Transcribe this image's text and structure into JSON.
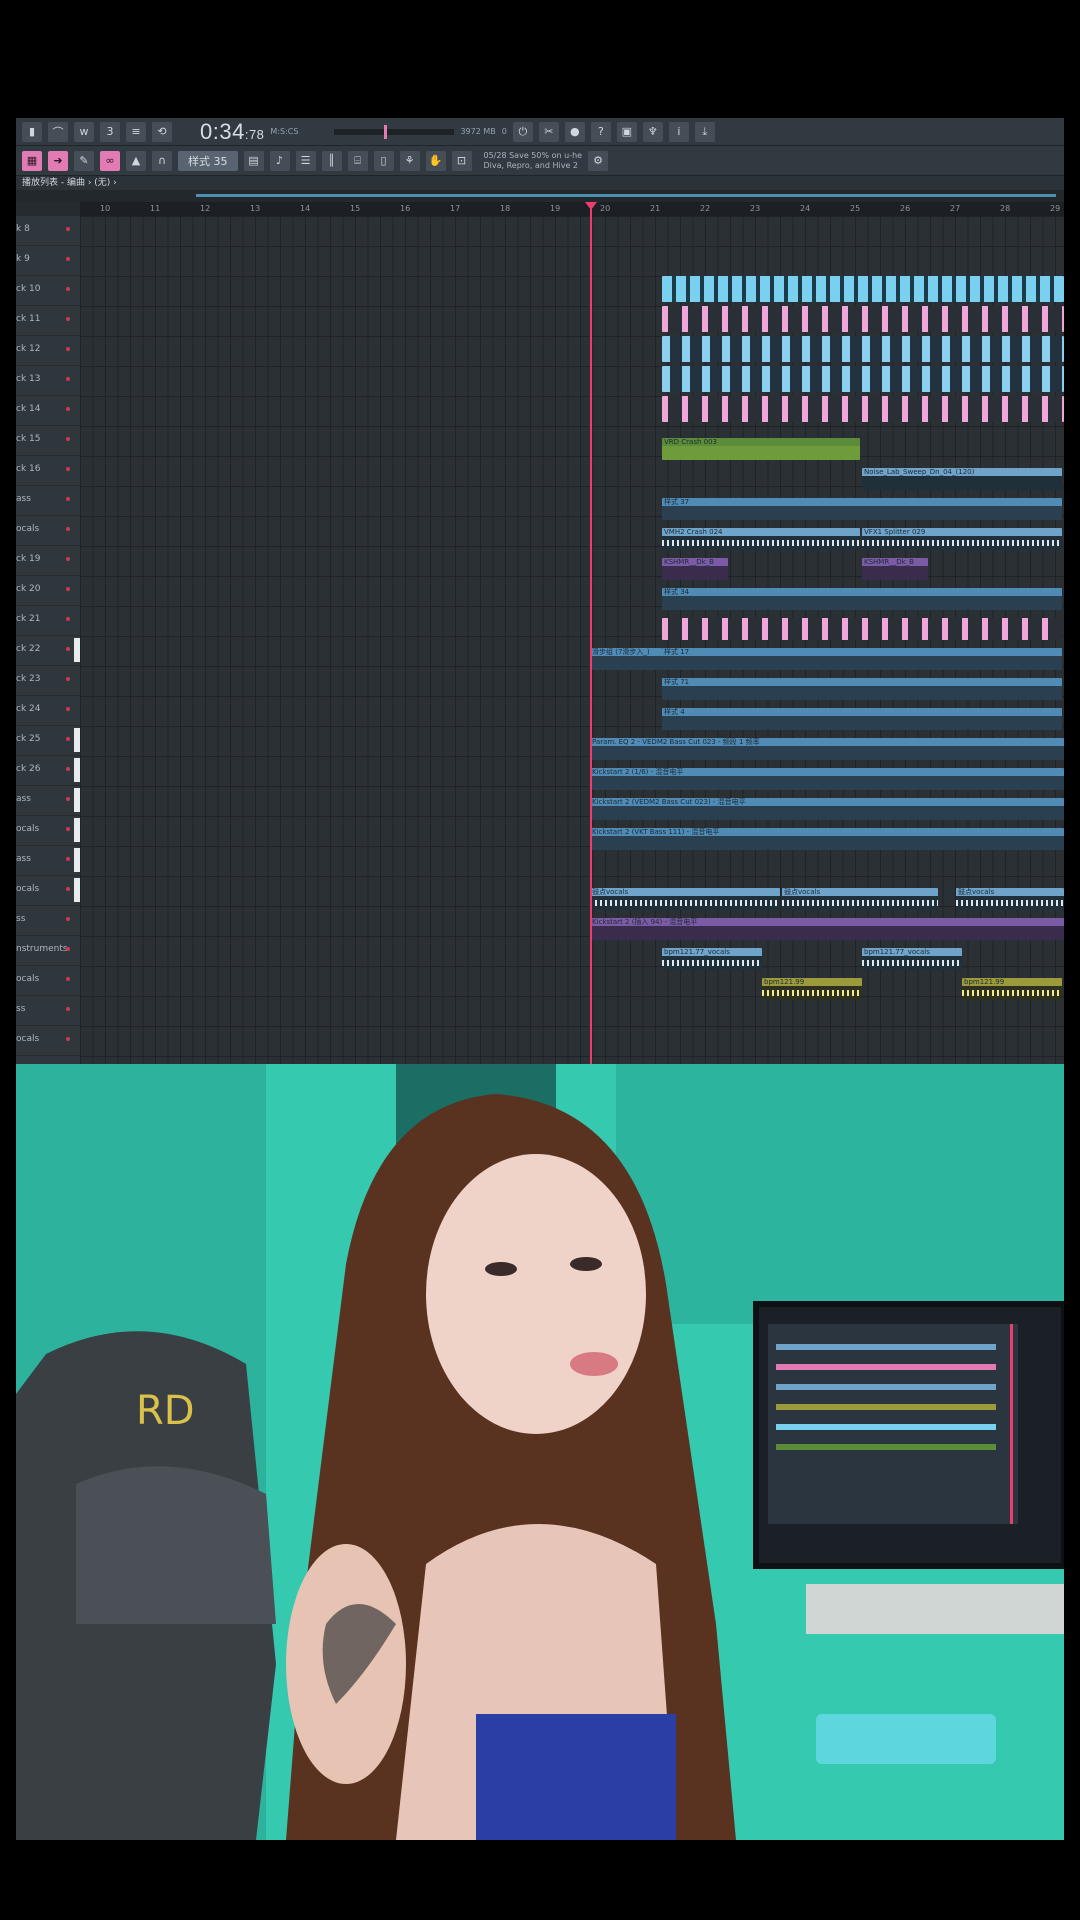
{
  "toolbar": {
    "time_main": "0:34",
    "time_frac": "78",
    "time_unit": "M:S:CS",
    "cpu_label": "3972 MB",
    "cpu_value": "0",
    "pattern_selector": "样式 35",
    "promo_line1": "05/28  Save 50% on u-he",
    "promo_line2": "Diva, Repro, and Hive 2"
  },
  "breadcrumb": "播放列表 - 编曲 › (无) ›",
  "ruler_numbers": [
    "10",
    "11",
    "12",
    "13",
    "14",
    "15",
    "16",
    "17",
    "18",
    "19",
    "20",
    "21",
    "22",
    "23",
    "24",
    "25",
    "26",
    "27",
    "28",
    "29"
  ],
  "track_names": [
    "k 8",
    "k 9",
    "ck 10",
    "ck 11",
    "ck 12",
    "ck 13",
    "ck 14",
    "ck 15",
    "ck 16",
    "ass",
    "ocals",
    "ck 19",
    "ck 20",
    "ck 21",
    "ck 22",
    "ck 23",
    "ck 24",
    "ck 25",
    "ck 26",
    "ass",
    "ocals",
    "ass",
    "ocals",
    "ss",
    "nstruments",
    "ocals",
    "ss",
    "ocals"
  ],
  "clips": {
    "fx_crash": "VRD Crash 003",
    "noise_sweep": "Noise_Lab_Sweep_Dn_04_(120)",
    "pattern_37": "样式 37",
    "vinyl_crash": "VMH2 Crash 024",
    "vfx_splitter": "VFX1 Splitter 029",
    "kshmr": "KSHMR__Dk_B",
    "pattern_34": "样式 34",
    "pattern_17": "样式 17",
    "intro_label": "滑步组 (7滑步入_)",
    "pattern_71": "样式 71",
    "pattern_4": "样式 4",
    "param_eq": "Param. EQ 2 - VEDM2 Bass Cut 023 - 频段 1 频率",
    "kickstart_1": "Kickstart 2 (1/6) - 混音电平",
    "kickstart_2": "Kickstart 2 (VEDM2 Bass Cut 023) - 混音电平",
    "kickstart_3": "Kickstart 2 (VKT Bass 111) - 混音电平",
    "vocals_a": "鼓点vocals",
    "vocals_b": "鼓点vocals",
    "vocals_c": "鼓点vocals",
    "kickstart_4": "Kickstart 2 (插入 94) - 混音电平",
    "bpm_vocals_a": "bpm121.77_vocals",
    "bpm_vocals_b": "bpm121.77_vocals",
    "bpm_a": "bpm121.99",
    "bpm_b": "bpm121.99"
  },
  "colors": {
    "accent_pink": "#e27ab3",
    "playhead": "#ef3d6b",
    "clip_blue": "#6fa3c9",
    "clip_green": "#5b8c3a",
    "clip_yellow": "#9c9a3a"
  },
  "photo": {
    "description": "webcam-feed"
  }
}
